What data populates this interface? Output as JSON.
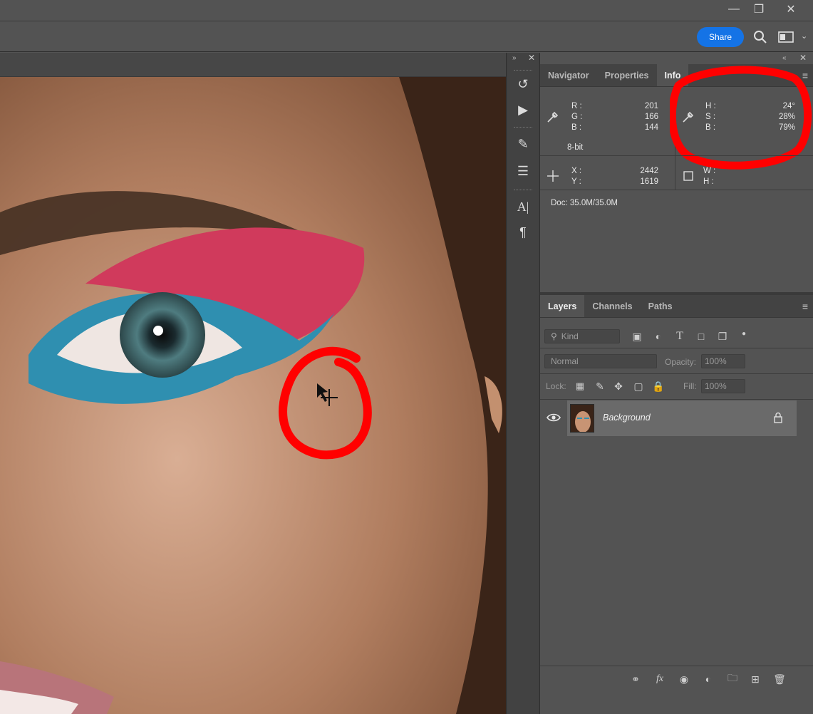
{
  "titlebar": {
    "minimize_icon": "minimize-icon",
    "restore_icon": "restore-icon",
    "close_icon": "close-icon"
  },
  "optionsbar": {
    "share_label": "Share"
  },
  "info_panel": {
    "tabs": [
      {
        "label": "Navigator",
        "active": false
      },
      {
        "label": "Properties",
        "active": false
      },
      {
        "label": "Info",
        "active": true
      }
    ],
    "rgb": {
      "r_label": "R :",
      "g_label": "G :",
      "b_label": "B :",
      "r": "201",
      "g": "166",
      "b": "144"
    },
    "hsb": {
      "h_label": "H :",
      "s_label": "S :",
      "b_label": "B :",
      "h": "24°",
      "s": "28%",
      "b": "79%"
    },
    "bit_depth": "8-bit",
    "xy": {
      "x_label": "X :",
      "y_label": "Y :",
      "x": "2442",
      "y": "1619"
    },
    "wh": {
      "w_label": "W :",
      "h_label": "H :"
    },
    "doc": "Doc: 35.0M/35.0M"
  },
  "layers_panel": {
    "tabs": [
      {
        "label": "Layers",
        "active": true
      },
      {
        "label": "Channels",
        "active": false
      },
      {
        "label": "Paths",
        "active": false
      }
    ],
    "filter_label": "Kind",
    "blend_mode": "Normal",
    "opacity_label": "Opacity:",
    "opacity_value": "100%",
    "lock_label": "Lock:",
    "fill_label": "Fill:",
    "fill_value": "100%",
    "layers": [
      {
        "name": "Background",
        "visible": true,
        "locked": true
      }
    ]
  },
  "colors": {
    "accent": "#1473e6",
    "annotation": "#ff0000",
    "panel_bg": "#535353"
  }
}
